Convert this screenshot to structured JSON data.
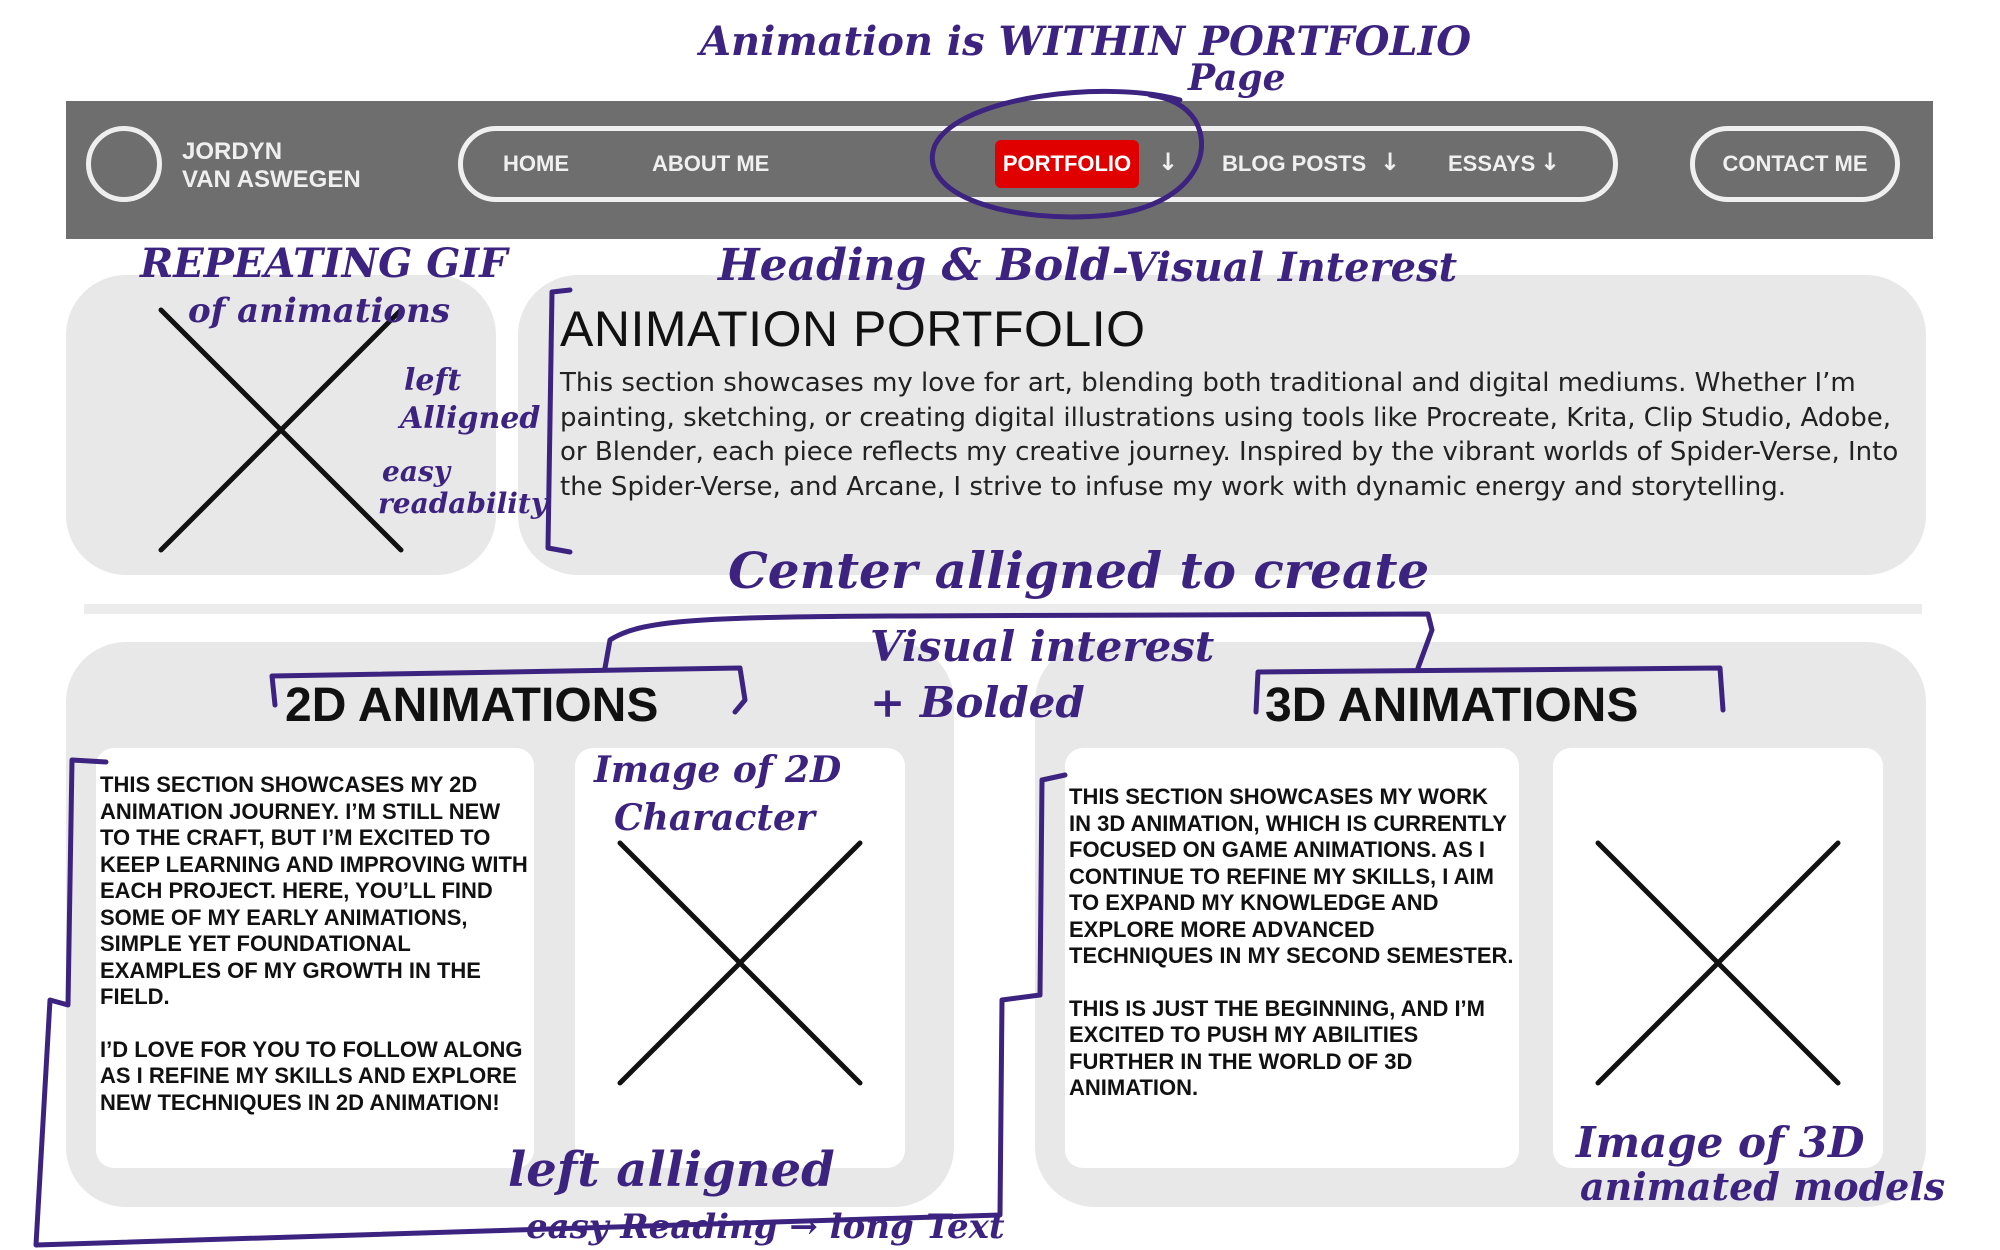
{
  "nav": {
    "brand_line1": "JORDYN",
    "brand_line2": "VAN ASWEGEN",
    "items": [
      "HOME",
      "ABOUT ME",
      "PORTFOLIO",
      "BLOG POSTS",
      "ESSAYS"
    ],
    "arrow": "↓",
    "contact": "CONTACT ME"
  },
  "hero": {
    "title": "ANIMATION PORTFOLIO",
    "description": "This section showcases my love for art, blending both traditional and digital mediums. Whether I’m painting, sketching, or creating digital illustrations using tools like Procreate, Krita, Clip Studio, Adobe, or Blender, each piece reflects my creative journey. Inspired by the vibrant worlds of Spider-Verse, Into the Spider-Verse, and Arcane, I strive to infuse my work with dynamic energy and storytelling."
  },
  "section_2d": {
    "title": "2D ANIMATIONS",
    "paragraph1": "THIS SECTION SHOWCASES MY 2D ANIMATION JOURNEY. I’M STILL NEW TO THE CRAFT, BUT I’M EXCITED TO KEEP LEARNING AND IMPROVING WITH EACH PROJECT. HERE, YOU’LL FIND SOME OF MY EARLY ANIMATIONS, SIMPLE YET FOUNDATIONAL EXAMPLES OF MY GROWTH IN THE FIELD.",
    "paragraph2": "I’D LOVE FOR YOU TO FOLLOW ALONG AS I REFINE MY SKILLS AND EXPLORE NEW TECHNIQUES IN 2D ANIMATION!"
  },
  "section_3d": {
    "title": "3D ANIMATIONS",
    "paragraph1": "THIS SECTION SHOWCASES MY WORK IN 3D ANIMATION, WHICH IS CURRENTLY FOCUSED ON GAME ANIMATIONS. AS I CONTINUE TO REFINE MY SKILLS, I AIM TO EXPAND MY KNOWLEDGE AND EXPLORE MORE ADVANCED TECHNIQUES IN MY SECOND SEMESTER.",
    "paragraph2": "THIS IS JUST THE BEGINNING, AND I’M EXCITED TO PUSH MY ABILITIES FURTHER IN THE WORLD OF 3D ANIMATION."
  },
  "annotations": {
    "top_line1": "Animation is WITHIN PORTFOLIO",
    "top_line2": "Page",
    "gif_line1": "REPEATING GIF",
    "gif_line2": "of animations",
    "left_aligned_1": "left",
    "left_aligned_2": "Alligned",
    "easy_1": "easy",
    "easy_2": "readability",
    "heading_bold": "Heading & Bold",
    "visual_interest": "-Visual Interest",
    "center_1": "Center alligned to create",
    "center_2": "Visual interest",
    "center_3": "+ Bolded",
    "image_2d_1": "Image of 2D",
    "image_2d_2": "Character",
    "bottom_left_1": "left alligned",
    "bottom_left_2": "easy Reading → long Text",
    "image_3d_1": "Image of 3D",
    "image_3d_2": "animated models"
  },
  "colors": {
    "nav_bg": "#6e6e6e",
    "active_tab": "#e00000",
    "card_bg": "#e8e8e8",
    "annotation_ink": "#3d2380"
  }
}
